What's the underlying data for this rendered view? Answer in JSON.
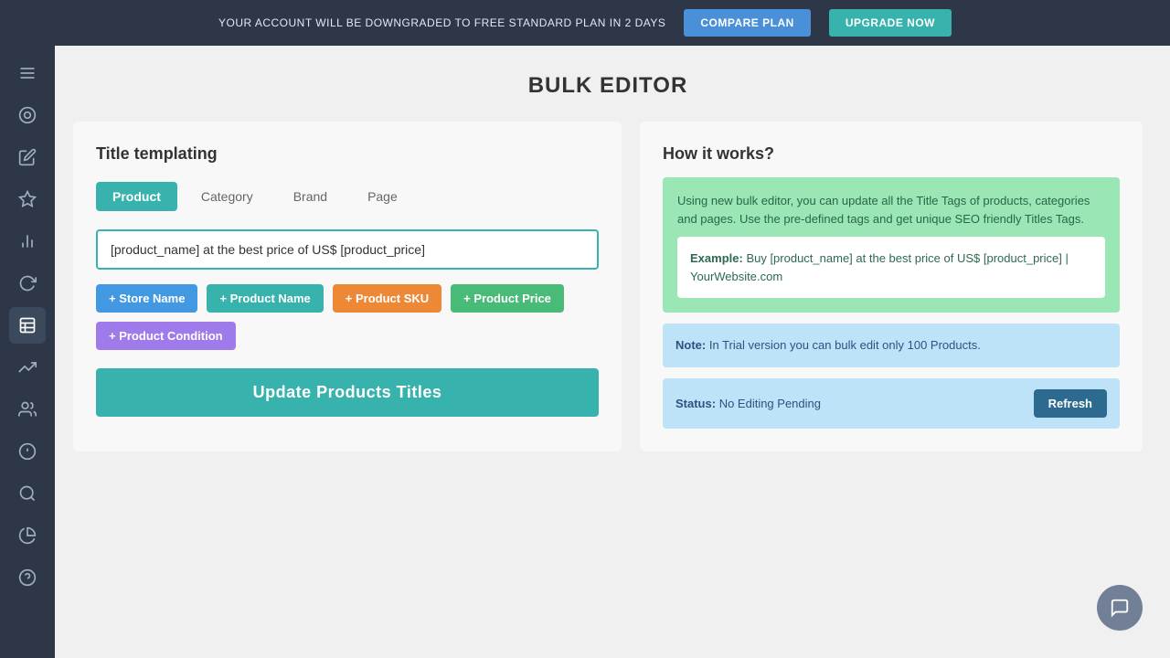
{
  "banner": {
    "text": "YOUR ACCOUNT WILL BE DOWNGRADED TO FREE STANDARD PLAN IN 2 DAYS",
    "compare_label": "COMPARE PLAN",
    "upgrade_label": "UPGRADE NOW"
  },
  "sidebar": {
    "items": [
      {
        "name": "menu-icon",
        "icon": "menu"
      },
      {
        "name": "palette-icon",
        "icon": "palette"
      },
      {
        "name": "edit-icon",
        "icon": "edit"
      },
      {
        "name": "star-icon",
        "icon": "star"
      },
      {
        "name": "chart-icon",
        "icon": "chart"
      },
      {
        "name": "refresh-icon",
        "icon": "refresh"
      },
      {
        "name": "table-icon",
        "icon": "table",
        "active": true
      },
      {
        "name": "trending-icon",
        "icon": "trending"
      },
      {
        "name": "group-icon",
        "icon": "group"
      },
      {
        "name": "alert-icon",
        "icon": "alert"
      },
      {
        "name": "search-icon",
        "icon": "search"
      },
      {
        "name": "pie-icon",
        "icon": "pie"
      },
      {
        "name": "help-icon",
        "icon": "help"
      }
    ]
  },
  "page": {
    "title": "BULK EDITOR"
  },
  "title_templating": {
    "heading": "Title templating",
    "tabs": [
      {
        "label": "Product",
        "active": true
      },
      {
        "label": "Category",
        "active": false
      },
      {
        "label": "Brand",
        "active": false
      },
      {
        "label": "Page",
        "active": false
      }
    ],
    "template_value": "[product_name] at the best price of US$ [product_price]",
    "tag_buttons": [
      {
        "label": "+ Store Name",
        "color": "blue"
      },
      {
        "label": "+ Product Name",
        "color": "teal"
      },
      {
        "label": "+ Product SKU",
        "color": "orange"
      },
      {
        "label": "+ Product Price",
        "color": "green"
      },
      {
        "label": "+ Product Condition",
        "color": "purple"
      }
    ],
    "update_button": "Update Products Titles"
  },
  "how_it_works": {
    "heading": "How it works?",
    "description": "Using new bulk editor, you can update all the Title Tags of products, categories and pages. Use the pre-defined tags and get unique SEO friendly Titles Tags.",
    "example_label": "Example:",
    "example_text": "Buy [product_name] at the best price of US$ [product_price] | YourWebsite.com",
    "note_label": "Note:",
    "note_text": "In Trial version you can bulk edit only 100 Products.",
    "status_label": "Status:",
    "status_value": "No Editing Pending",
    "refresh_label": "Refresh"
  }
}
